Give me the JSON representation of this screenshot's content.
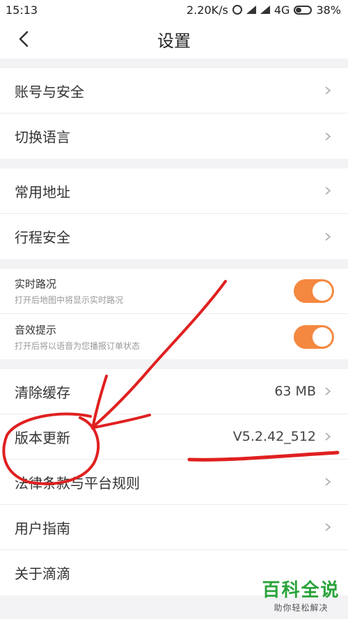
{
  "statusbar": {
    "time": "15:13",
    "speed": "2.20K/s",
    "network": "4G",
    "battery": "38%"
  },
  "navbar": {
    "title": "设置",
    "back_icon": "chevron-left-icon"
  },
  "groups": {
    "account": {
      "items": [
        {
          "label": "账号与安全"
        },
        {
          "label": "切换语言"
        }
      ]
    },
    "travel": {
      "items": [
        {
          "label": "常用地址"
        },
        {
          "label": "行程安全"
        }
      ]
    },
    "toggles": {
      "items": [
        {
          "title": "实时路况",
          "subtitle": "打开后地图中将显示实时路况",
          "on": true
        },
        {
          "title": "音效提示",
          "subtitle": "打开后将以语音为您播报订单状态",
          "on": true
        }
      ]
    },
    "misc": {
      "items": [
        {
          "label": "清除缓存",
          "value": "63 MB"
        },
        {
          "label": "版本更新",
          "value": "V5.2.42_512"
        },
        {
          "label": "法律条款与平台规则"
        },
        {
          "label": "用户指南"
        },
        {
          "label": "关于滴滴"
        }
      ]
    }
  },
  "colors": {
    "toggle_on": "#f58840",
    "annotation": "#e02020",
    "watermark": "#2aa33a"
  },
  "watermark": {
    "line1": "百科全说",
    "line2": "助你轻松解决"
  }
}
